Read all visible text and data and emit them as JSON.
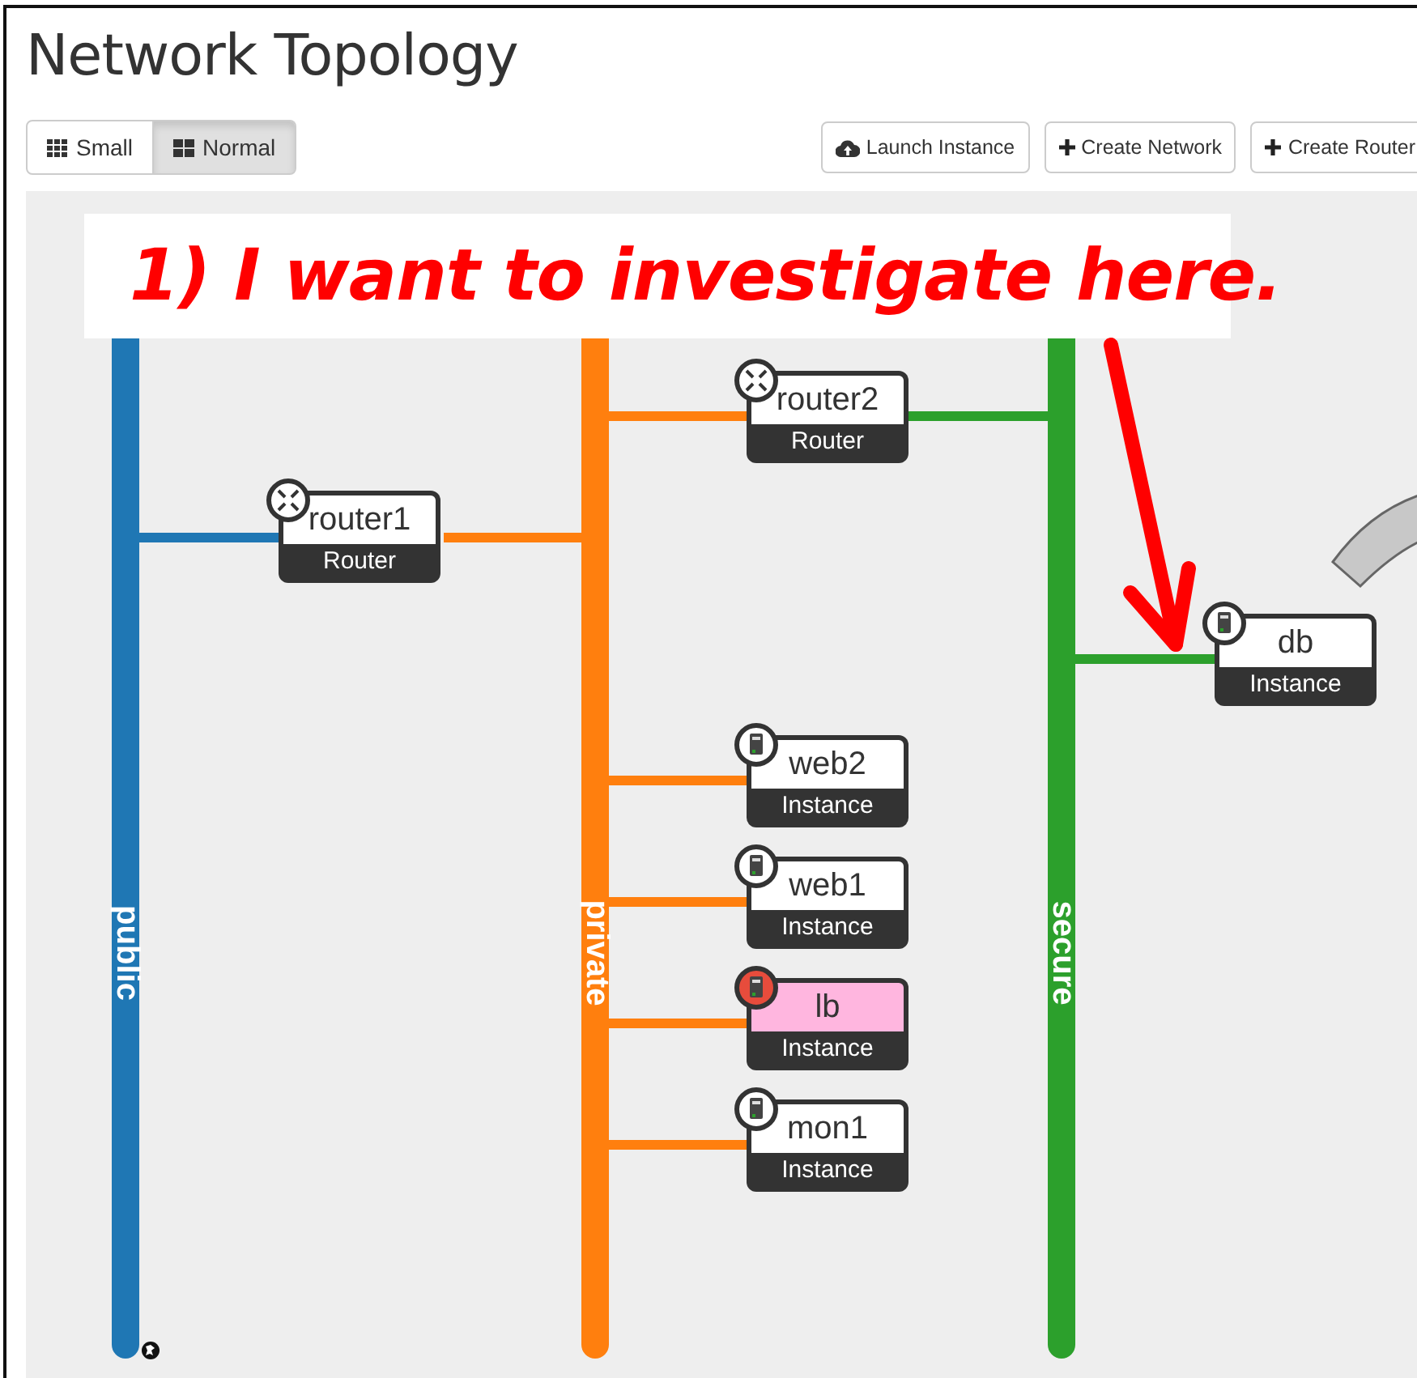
{
  "page": {
    "title": "Network Topology"
  },
  "view_toggle": [
    {
      "label": "Small",
      "selected": false
    },
    {
      "label": "Normal",
      "selected": true
    }
  ],
  "actions": [
    {
      "label": "Launch Instance",
      "kind": "cloud"
    },
    {
      "label": "Create Network",
      "kind": "plus"
    },
    {
      "label": "Create Router",
      "kind": "plus"
    }
  ],
  "networks": [
    {
      "name": "public",
      "color": "#1f77b4",
      "external": true
    },
    {
      "name": "private",
      "color": "#ff7f0e",
      "external": false
    },
    {
      "name": "secure",
      "color": "#2ca02c",
      "external": false
    }
  ],
  "nodes": [
    {
      "name": "router1",
      "type": "Router",
      "kind": "router",
      "error": false
    },
    {
      "name": "router2",
      "type": "Router",
      "kind": "router",
      "error": false
    },
    {
      "name": "db",
      "type": "Instance",
      "kind": "instance",
      "error": false
    },
    {
      "name": "web2",
      "type": "Instance",
      "kind": "instance",
      "error": false
    },
    {
      "name": "web1",
      "type": "Instance",
      "kind": "instance",
      "error": false
    },
    {
      "name": "lb",
      "type": "Instance",
      "kind": "instance",
      "error": true
    },
    {
      "name": "mon1",
      "type": "Instance",
      "kind": "instance",
      "error": false
    }
  ],
  "annotation": {
    "text": "1) I want to investigate here."
  }
}
